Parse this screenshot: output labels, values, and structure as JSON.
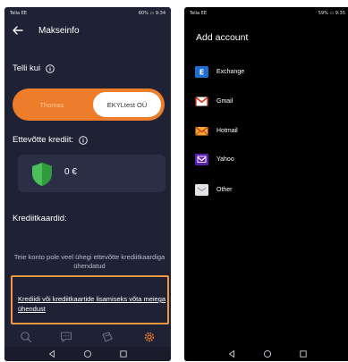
{
  "left_phone": {
    "status": {
      "carrier": "Telia EE",
      "battery": "60%",
      "time": "9:34"
    },
    "title": "Makseinfo",
    "order_as_label": "Telli kui",
    "toggle": {
      "left_option": "Thomas",
      "right_option": "EKYLtest OÜ",
      "selected": "right"
    },
    "company_credit_label": "Ettevõtte krediit:",
    "credit_value": "0 €",
    "credit_cards_label": "Krediitkaardid:",
    "empty_message": "Teie konto pole veel ühegi ettevõtte krediitkaardiga ühendatud",
    "contact_link": "Krediidi või krediitkaartide lisamiseks võta meiega ühendust",
    "highlight_color": "#f0963f",
    "accent_color": "#ee7d2b",
    "tabs": [
      "search-icon",
      "chat-icon",
      "cart-icon",
      "settings-icon"
    ],
    "active_tab": "settings-icon"
  },
  "right_phone": {
    "status": {
      "carrier": "Telia EE",
      "battery": "59%",
      "time": "9:35"
    },
    "title": "Add account",
    "accounts": [
      {
        "label": "Exchange",
        "icon": "exchange-icon"
      },
      {
        "label": "Gmail",
        "icon": "gmail-icon"
      },
      {
        "label": "Hotmail",
        "icon": "hotmail-icon"
      },
      {
        "label": "Yahoo",
        "icon": "yahoo-icon"
      },
      {
        "label": "Other",
        "icon": "mail-icon"
      }
    ]
  }
}
